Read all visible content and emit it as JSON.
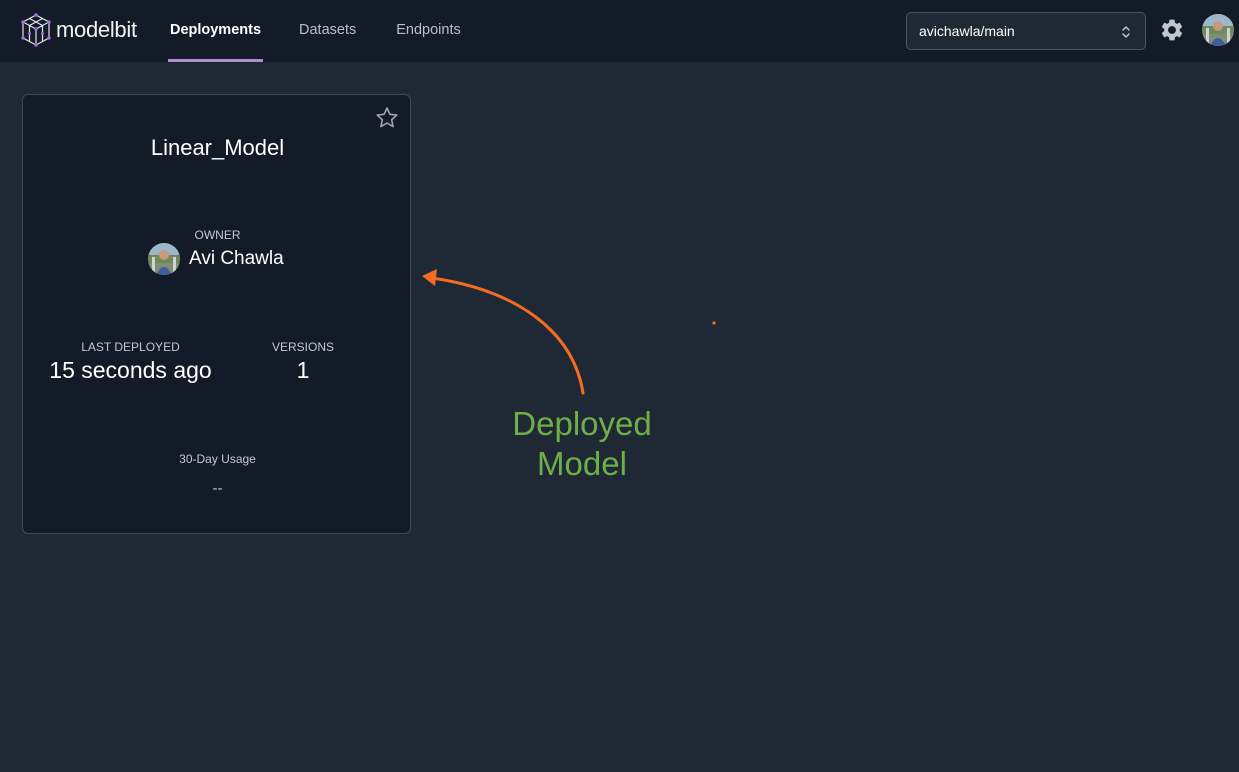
{
  "brand": {
    "name": "modelbit"
  },
  "nav": {
    "tabs": [
      {
        "label": "Deployments",
        "active": true
      },
      {
        "label": "Datasets",
        "active": false
      },
      {
        "label": "Endpoints",
        "active": false
      }
    ]
  },
  "branch_selector": {
    "value": "avichawla/main"
  },
  "icons": {
    "logo": "cube-logo-icon",
    "settings": "gear-icon",
    "favorite": "star-outline-icon",
    "select": "chevron-up-down-icon"
  },
  "deployment_card": {
    "name": "Linear_Model",
    "owner_label": "OWNER",
    "owner_name": "Avi Chawla",
    "last_deployed_label": "LAST DEPLOYED",
    "last_deployed_value": "15 seconds ago",
    "versions_label": "VERSIONS",
    "versions_value": "1",
    "usage_label": "30-Day Usage",
    "usage_value": "--"
  },
  "annotation": {
    "line1": "Deployed",
    "line2": "Model",
    "text_color": "#6faf48",
    "arrow_color": "#f26d21"
  },
  "colors": {
    "page_bg": "#1f2935",
    "topbar_bg": "#141b28",
    "card_bg": "#141b28",
    "active_tab_underline": "#b48ad4",
    "logo_accent": "#a66bd9"
  }
}
